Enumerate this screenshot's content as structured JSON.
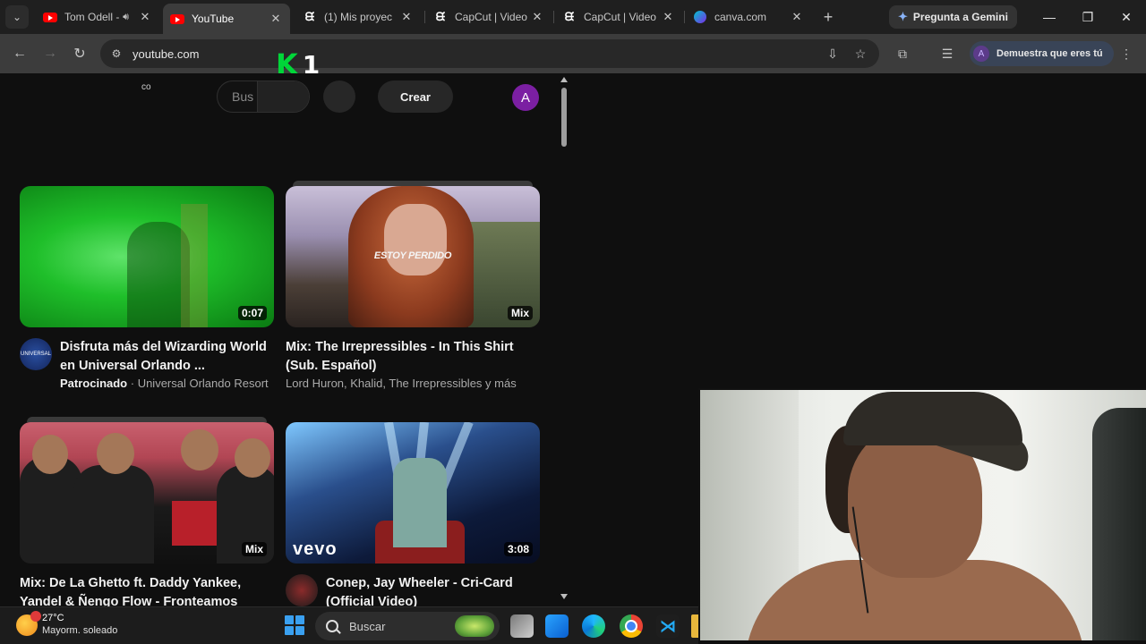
{
  "browser": {
    "tabs": [
      {
        "title": "Tom Odell -",
        "favicon": "youtube-icon",
        "audio": true,
        "active": false
      },
      {
        "title": "YouTube",
        "favicon": "youtube-icon",
        "audio": false,
        "active": true
      },
      {
        "title": "(1) Mis proyec",
        "favicon": "capcut-icon",
        "audio": false,
        "active": false
      },
      {
        "title": "CapCut | Video",
        "favicon": "capcut-icon",
        "audio": false,
        "active": false
      },
      {
        "title": "CapCut | Video",
        "favicon": "capcut-icon",
        "audio": false,
        "active": false
      },
      {
        "title": "canva.com",
        "favicon": "canva-icon",
        "audio": false,
        "active": false
      }
    ],
    "gemini_label": "Pregunta a Gemini",
    "url": "youtube.com",
    "profile_label": "Demuestra que eres tú",
    "profile_initial": "A"
  },
  "overlay": {
    "k": "K",
    "number": "1"
  },
  "youtube": {
    "co_label": "co",
    "search_placeholder": "Bus",
    "create_label": "Crear",
    "avatar_initial": "A",
    "videos": [
      {
        "title": "Disfruta más del Wizarding World en Universal Orlando ...",
        "sponsored_label": "Patrocinado",
        "channel": "Universal Orlando Resort",
        "badge": "0:07",
        "channel_avatar_text": "UNIVERSAL"
      },
      {
        "title": "Mix: The Irrepressibles - In This Shirt (Sub. Español)",
        "channel": "Lord Huron, Khalid, The Irrepressibles y más",
        "badge": "Mix",
        "thumbnail_text": "ESTOY PERDIDO"
      },
      {
        "title": "Mix: De La Ghetto ft. Daddy Yankee, Yandel & Ñengo Flow - Fronteamos",
        "channel": "",
        "badge": "Mix"
      },
      {
        "title": "Conep, Jay Wheeler - Cri-Card (Official Video)",
        "channel": "",
        "badge": "3:08",
        "thumbnail_logo": "vevo"
      }
    ]
  },
  "taskbar": {
    "temperature": "27°C",
    "weather": "Mayorm. soleado",
    "search_label": "Buscar"
  }
}
